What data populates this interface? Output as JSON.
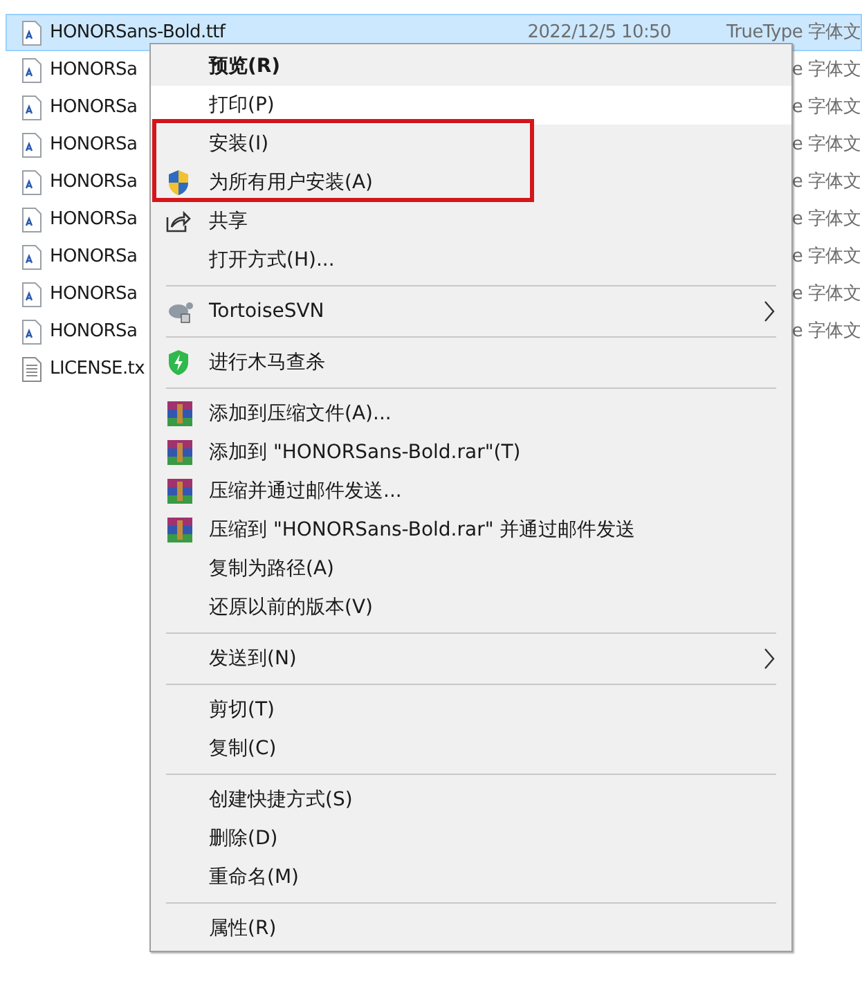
{
  "files": [
    {
      "name": "HONORSans-Bold.ttf",
      "date": "2022/12/5 10:50",
      "type": "TrueType 字体文",
      "kind": "font",
      "selected": true
    },
    {
      "name": "HONORSa",
      "type": "e 字体文",
      "kind": "font",
      "selected": false
    },
    {
      "name": "HONORSa",
      "type": "e 字体文",
      "kind": "font",
      "selected": false
    },
    {
      "name": "HONORSa",
      "type": "e 字体文",
      "kind": "font",
      "selected": false
    },
    {
      "name": "HONORSa",
      "type": "e 字体文",
      "kind": "font",
      "selected": false
    },
    {
      "name": "HONORSa",
      "type": "e 字体文",
      "kind": "font",
      "selected": false
    },
    {
      "name": "HONORSa",
      "type": "e 字体文",
      "kind": "font",
      "selected": false
    },
    {
      "name": "HONORSa",
      "type": "e 字体文",
      "kind": "font",
      "selected": false
    },
    {
      "name": "HONORSa",
      "type": "e 字体文",
      "kind": "font",
      "selected": false
    },
    {
      "name": "LICENSE.tx",
      "kind": "text",
      "selected": false
    }
  ],
  "context_menu": [
    {
      "kind": "item",
      "label": "预览(R)",
      "bold": true,
      "selected": false
    },
    {
      "kind": "item",
      "label": "打印(P)",
      "selected": true
    },
    {
      "kind": "item",
      "label": "安装(I)",
      "selected": false
    },
    {
      "kind": "shield",
      "label": "为所有用户安装(A)",
      "selected": false
    },
    {
      "kind": "share",
      "label": "共享",
      "selected": false
    },
    {
      "kind": "item",
      "label": "打开方式(H)...",
      "selected": false
    },
    {
      "kind": "separator"
    },
    {
      "kind": "svn",
      "label": "TortoiseSVN",
      "submenu": true,
      "selected": false
    },
    {
      "kind": "separator"
    },
    {
      "kind": "scan",
      "label": "进行木马查杀",
      "selected": false
    },
    {
      "kind": "separator"
    },
    {
      "kind": "archive",
      "label": "添加到压缩文件(A)...",
      "selected": false
    },
    {
      "kind": "archive",
      "label": "添加到 \"HONORSans-Bold.rar\"(T)",
      "selected": false
    },
    {
      "kind": "archive",
      "label": "压缩并通过邮件发送...",
      "selected": false
    },
    {
      "kind": "archive",
      "label": "压缩到 \"HONORSans-Bold.rar\" 并通过邮件发送",
      "selected": false
    },
    {
      "kind": "item",
      "label": "复制为路径(A)",
      "selected": false
    },
    {
      "kind": "item",
      "label": "还原以前的版本(V)",
      "selected": false
    },
    {
      "kind": "separator"
    },
    {
      "kind": "item",
      "label": "发送到(N)",
      "submenu": true,
      "selected": false
    },
    {
      "kind": "separator"
    },
    {
      "kind": "item",
      "label": "剪切(T)",
      "selected": false
    },
    {
      "kind": "item",
      "label": "复制(C)",
      "selected": false
    },
    {
      "kind": "separator"
    },
    {
      "kind": "item",
      "label": "创建快捷方式(S)",
      "selected": false
    },
    {
      "kind": "item",
      "label": "删除(D)",
      "selected": false
    },
    {
      "kind": "item",
      "label": "重命名(M)",
      "selected": false
    },
    {
      "kind": "separator"
    },
    {
      "kind": "item",
      "label": "属性(R)",
      "selected": false
    }
  ]
}
